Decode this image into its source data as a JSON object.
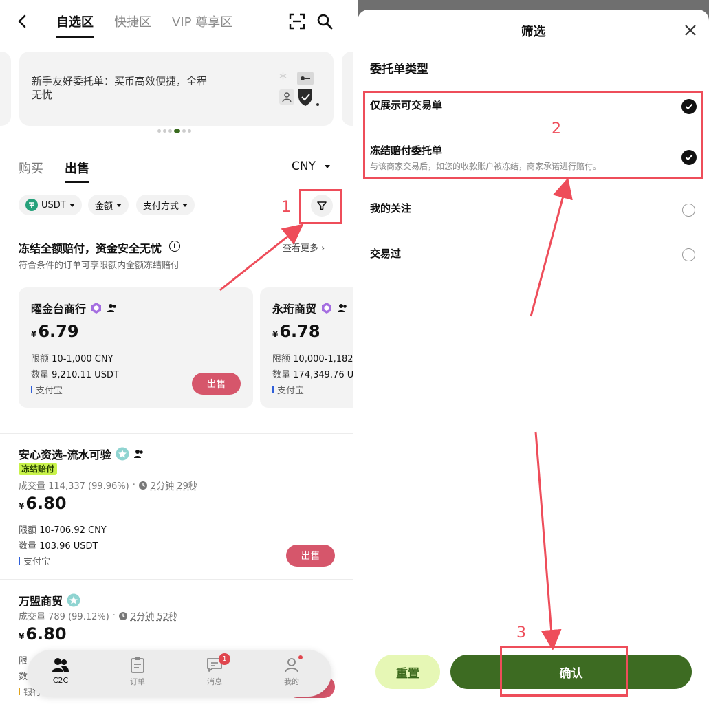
{
  "left": {
    "nav": {
      "tabs": [
        "自选区",
        "快捷区",
        "VIP 尊享区"
      ]
    },
    "banner": {
      "text": "新手友好委托单：买币高效便捷，全程无忧"
    },
    "trade_tabs": {
      "buy": "购买",
      "sell": "出售"
    },
    "currency": "CNY",
    "filters": {
      "coin": "USDT",
      "amount": "金额",
      "payment": "支付方式"
    },
    "section": {
      "title": "冻结全额赔付，资金安全无忧",
      "subtitle": "符合条件的订单可享限额内全额冻结赔付",
      "see_more": "查看更多",
      "info": "i"
    },
    "cards": [
      {
        "name": "曜金台商行",
        "currency_symbol": "¥",
        "price": "6.79",
        "limit_label": "限额",
        "limit": "10-1,000 CNY",
        "qty_label": "数量",
        "qty": "9,210.11 USDT",
        "payment": "支付宝",
        "action": "出售"
      },
      {
        "name": "永珩商贸",
        "currency_symbol": "¥",
        "price": "6.78",
        "limit_label": "限额",
        "limit": "10,000-1,182",
        "qty_label": "数量",
        "qty": "174,349.76 U",
        "payment": "支付宝"
      }
    ],
    "merchants": [
      {
        "name": "安心资选-流水可验",
        "badge": "冻结赔付",
        "stats": "成交量 114,337 (99.96%)",
        "sep": "·",
        "time": "2分钟 29秒",
        "currency_symbol": "¥",
        "price": "6.80",
        "limit_label": "限额",
        "limit": "10-706.92 CNY",
        "qty_label": "数量",
        "qty": "103.96 USDT",
        "payment": "支付宝",
        "action": "出售"
      },
      {
        "name": "万盟商贸",
        "stats": "成交量 789 (99.12%)",
        "sep": "·",
        "time": "2分钟 52秒",
        "currency_symbol": "¥",
        "price": "6.80",
        "limit_label": "限",
        "qty_label": "数",
        "payment": "银行"
      }
    ],
    "bottom_nav": [
      {
        "label": "C2C"
      },
      {
        "label": "订单"
      },
      {
        "label": "消息",
        "badge": "1"
      },
      {
        "label": "我的"
      }
    ]
  },
  "right": {
    "title": "筛选",
    "group_title": "委托单类型",
    "options": [
      {
        "label": "仅展示可交易单",
        "checked": true
      },
      {
        "label": "冻结赔付委托单",
        "sub": "与该商家交易后，如您的收款账户被冻结，商家承诺进行赔付。",
        "checked": true
      },
      {
        "label": "我的关注",
        "checked": false
      },
      {
        "label": "交易过",
        "checked": false
      }
    ],
    "reset": "重置",
    "confirm": "确认"
  },
  "annotations": [
    "1",
    "2",
    "3"
  ],
  "colors": {
    "accent": "#3d6b22",
    "annotation_red": "#ee4d5a",
    "sell_button": "#d6566b",
    "badge_green": "#c8f24a"
  }
}
